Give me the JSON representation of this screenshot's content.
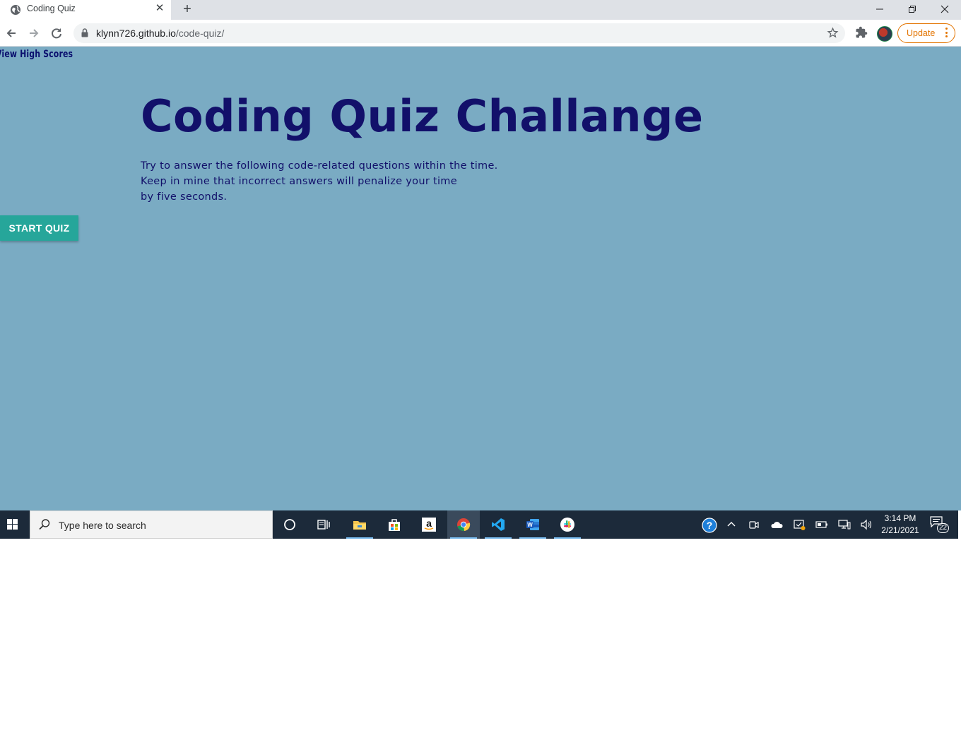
{
  "browser": {
    "tab_title": "Coding Quiz",
    "url_host": "klynn726.github.io",
    "url_path": "/code-quiz/",
    "update_label": "Update"
  },
  "page": {
    "view_high_scores": "View High Scores",
    "title": "Coding Quiz Challange",
    "instructions": [
      "Try to answer the following code-related questions within the time.",
      "Keep in mine that incorrect answers will penalize your time",
      "by five seconds."
    ],
    "start_button": "START QUIZ"
  },
  "taskbar": {
    "search_placeholder": "Type here to search",
    "apps": [
      "cortana-icon",
      "task-view-icon",
      "file-explorer-icon",
      "store-icon",
      "amazon-icon",
      "chrome-icon",
      "vscode-icon",
      "word-icon",
      "slack-icon"
    ],
    "time": "3:14 PM",
    "date": "2/21/2021",
    "notification_count": "22"
  },
  "colors": {
    "page_background": "#7aabc3",
    "heading": "#12106a",
    "start_button": "#26a69a",
    "taskbar": "#1c2a3a"
  }
}
